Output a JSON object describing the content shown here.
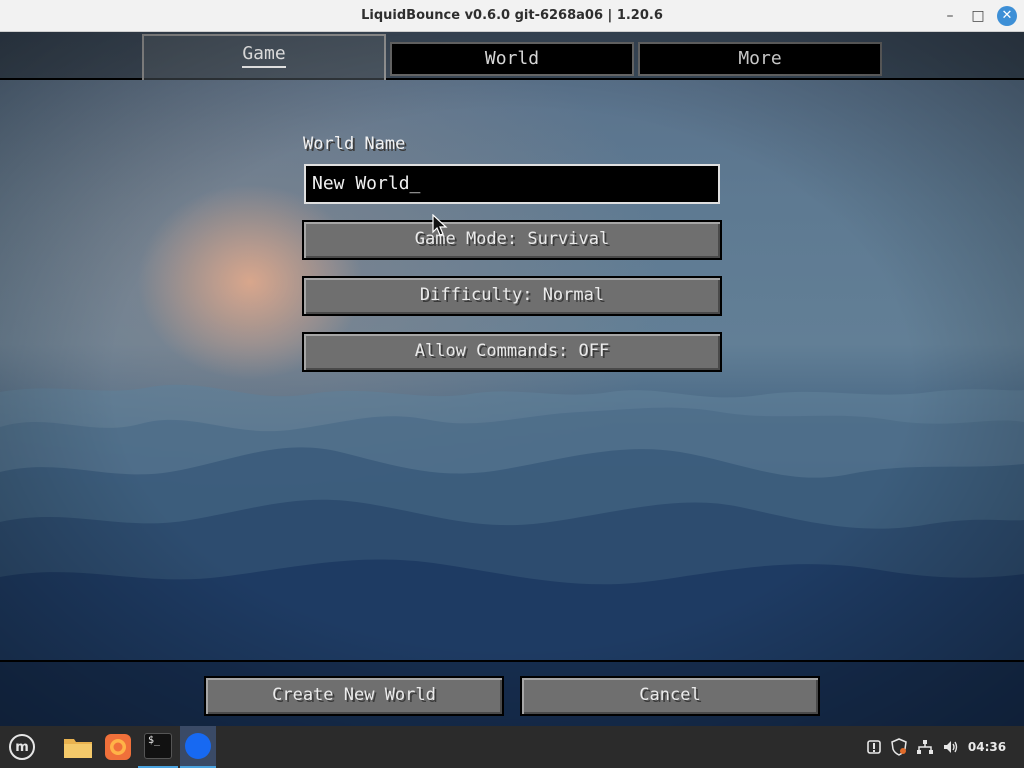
{
  "window": {
    "title": "LiquidBounce v0.6.0 git-6268a06 | 1.20.6",
    "min_icon": "–",
    "max_icon": "□",
    "close_icon": "✕"
  },
  "tabs": [
    {
      "label": "Game",
      "active": true
    },
    {
      "label": "World",
      "active": false
    },
    {
      "label": "More",
      "active": false
    }
  ],
  "form": {
    "world_name_label": "World Name",
    "world_name_value": "New World_",
    "game_mode_button": "Game Mode: Survival",
    "difficulty_button": "Difficulty: Normal",
    "allow_commands_button": "Allow Commands: OFF"
  },
  "actions": {
    "create_label": "Create New World",
    "cancel_label": "Cancel"
  },
  "taskbar": {
    "menu_icon": "m",
    "terminal_glyph": "$_",
    "clock": "04:36"
  },
  "colors": {
    "accent": "#4aa3df",
    "close_button": "#3d8fd6"
  }
}
